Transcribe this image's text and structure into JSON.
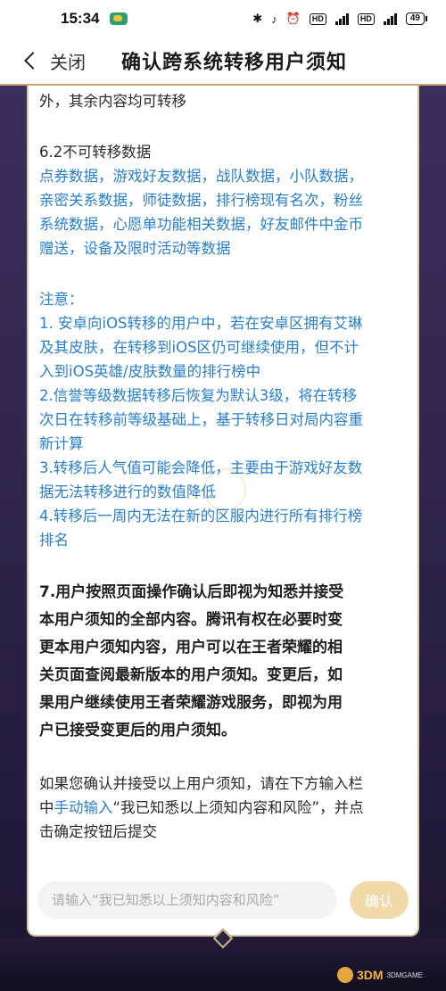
{
  "status_bar": {
    "time": "15:34",
    "battery": "49",
    "network_4g_1": "4G",
    "network_4g_2": "4G",
    "hd": "HD"
  },
  "header": {
    "back_label": "关闭",
    "title": "确认跨系统转移用户须知"
  },
  "content": {
    "top_line": "外，其余内容均可转移",
    "section_heading": "6.2不可转移数据",
    "non_transferable": [
      "点券数据，游戏好友数据，战队数据，小队数据，",
      "亲密关系数据，师徒数据，排行榜现有名次，粉丝",
      "系统数据，心愿单功能相关数据，好友邮件中金币",
      "赠送，设备及限时活动等数据"
    ],
    "notice_heading": "注意：",
    "notes": [
      "1. 安卓向iOS转移的用户中，若在安卓区拥有艾琳",
      "及其皮肤，在转移到iOS区仍可继续使用，但不计",
      "入到iOS英雄/皮肤数量的排行榜中",
      "2.信誉等级数据转移后恢复为默认3级，将在转移",
      "次日在转移前等级基础上，基于转移日对局内容重",
      "新计算",
      "3.转移后人气值可能会降低，主要由于游戏好友数",
      "据无法转移进行的数值降低",
      "4.转移后一周内无法在新的区服内进行所有排行榜",
      "排名"
    ],
    "clause_7": [
      "7.用户按照页面操作确认后即视为知悉并接受",
      "本用户须知的全部内容。腾讯有权在必要时变",
      "更本用户须知内容，用户可以在王者荣耀的相",
      "关页面查阅最新版本的用户须知。变更后，如",
      "果用户继续使用王者荣耀游戏服务，即视为用",
      "户已接受变更后的用户须知。"
    ],
    "instruction_line1": "如果您确认并接受以上用户须知，请在下方输入栏",
    "instruction_line2_prefix": "中",
    "instruction_link": "手动输入",
    "instruction_line2_suffix": "“我已知悉以上须知内容和风险”，并点",
    "instruction_line3": "击确定按钮后提交"
  },
  "form": {
    "input_placeholder": "请输入“我已知悉以上须知内容和风险”",
    "confirm_label": "确认"
  },
  "watermark": {
    "text": "3DM",
    "sub": "3DMGAME"
  },
  "colors": {
    "accent_blue": "#2a7fc7",
    "confirm_button": "#f2d9a9",
    "gold_border": "#c9a971"
  }
}
